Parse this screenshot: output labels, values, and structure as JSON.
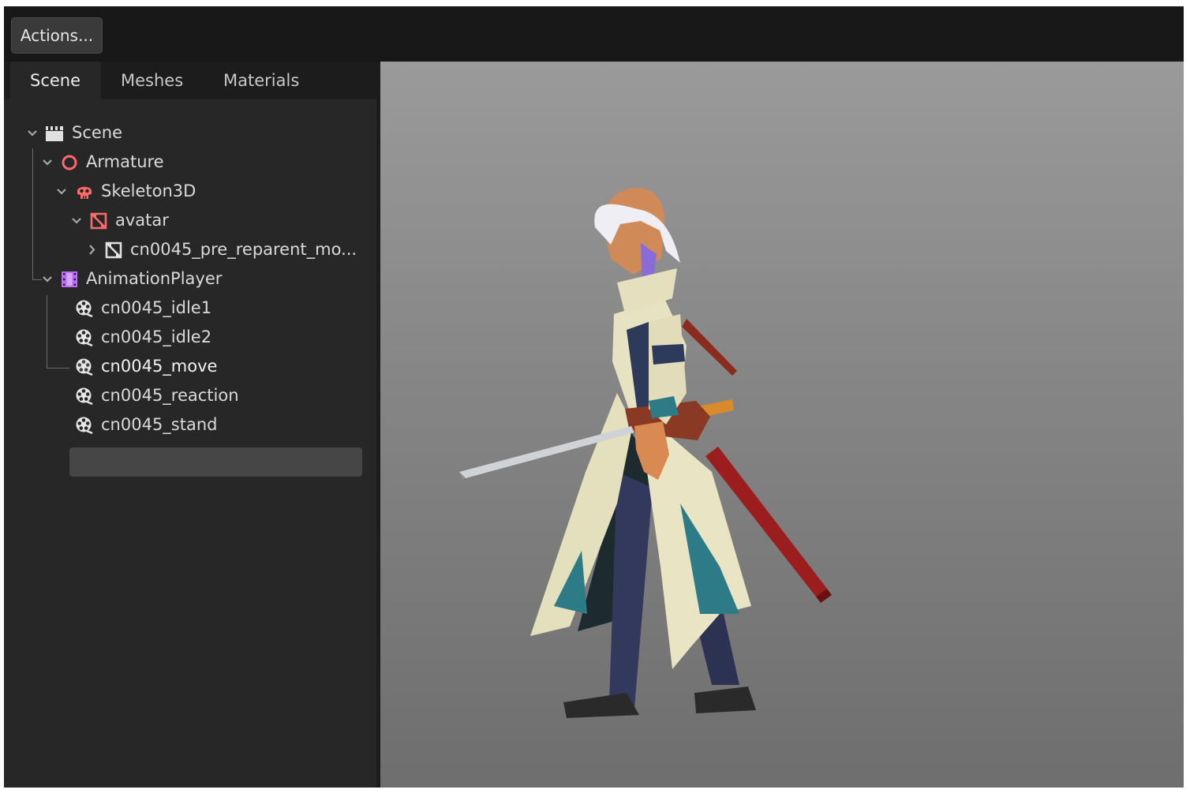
{
  "toolbar": {
    "actions_label": "Actions..."
  },
  "tabs": [
    {
      "label": "Scene",
      "active": true
    },
    {
      "label": "Meshes",
      "active": false
    },
    {
      "label": "Materials",
      "active": false
    }
  ],
  "tree": [
    {
      "label": "Scene",
      "icon": "clapperboard-icon",
      "expanded": true
    },
    {
      "label": "Armature",
      "icon": "node3d-circle-icon",
      "expanded": true
    },
    {
      "label": "Skeleton3D",
      "icon": "skull-icon",
      "expanded": true
    },
    {
      "label": "avatar",
      "icon": "mesh-instance-icon",
      "expanded": true
    },
    {
      "label": "cn0045_pre_reparent_mo...",
      "icon": "mesh-instance-icon",
      "expanded": false
    },
    {
      "label": "AnimationPlayer",
      "icon": "film-strip-icon",
      "expanded": true
    },
    {
      "label": "cn0045_idle1",
      "icon": "animation-reel-icon"
    },
    {
      "label": "cn0045_idle2",
      "icon": "animation-reel-icon"
    },
    {
      "label": "cn0045_move",
      "icon": "animation-reel-icon",
      "selected": true
    },
    {
      "label": "cn0045_reaction",
      "icon": "animation-reel-icon"
    },
    {
      "label": "cn0045_stand",
      "icon": "animation-reel-icon"
    }
  ],
  "viewport": {
    "content": "3D character preview"
  },
  "colors": {
    "panel": "#272727",
    "selection": "#464646",
    "node_red": "#fc6a6a",
    "anim_purple": "#c06bff"
  }
}
